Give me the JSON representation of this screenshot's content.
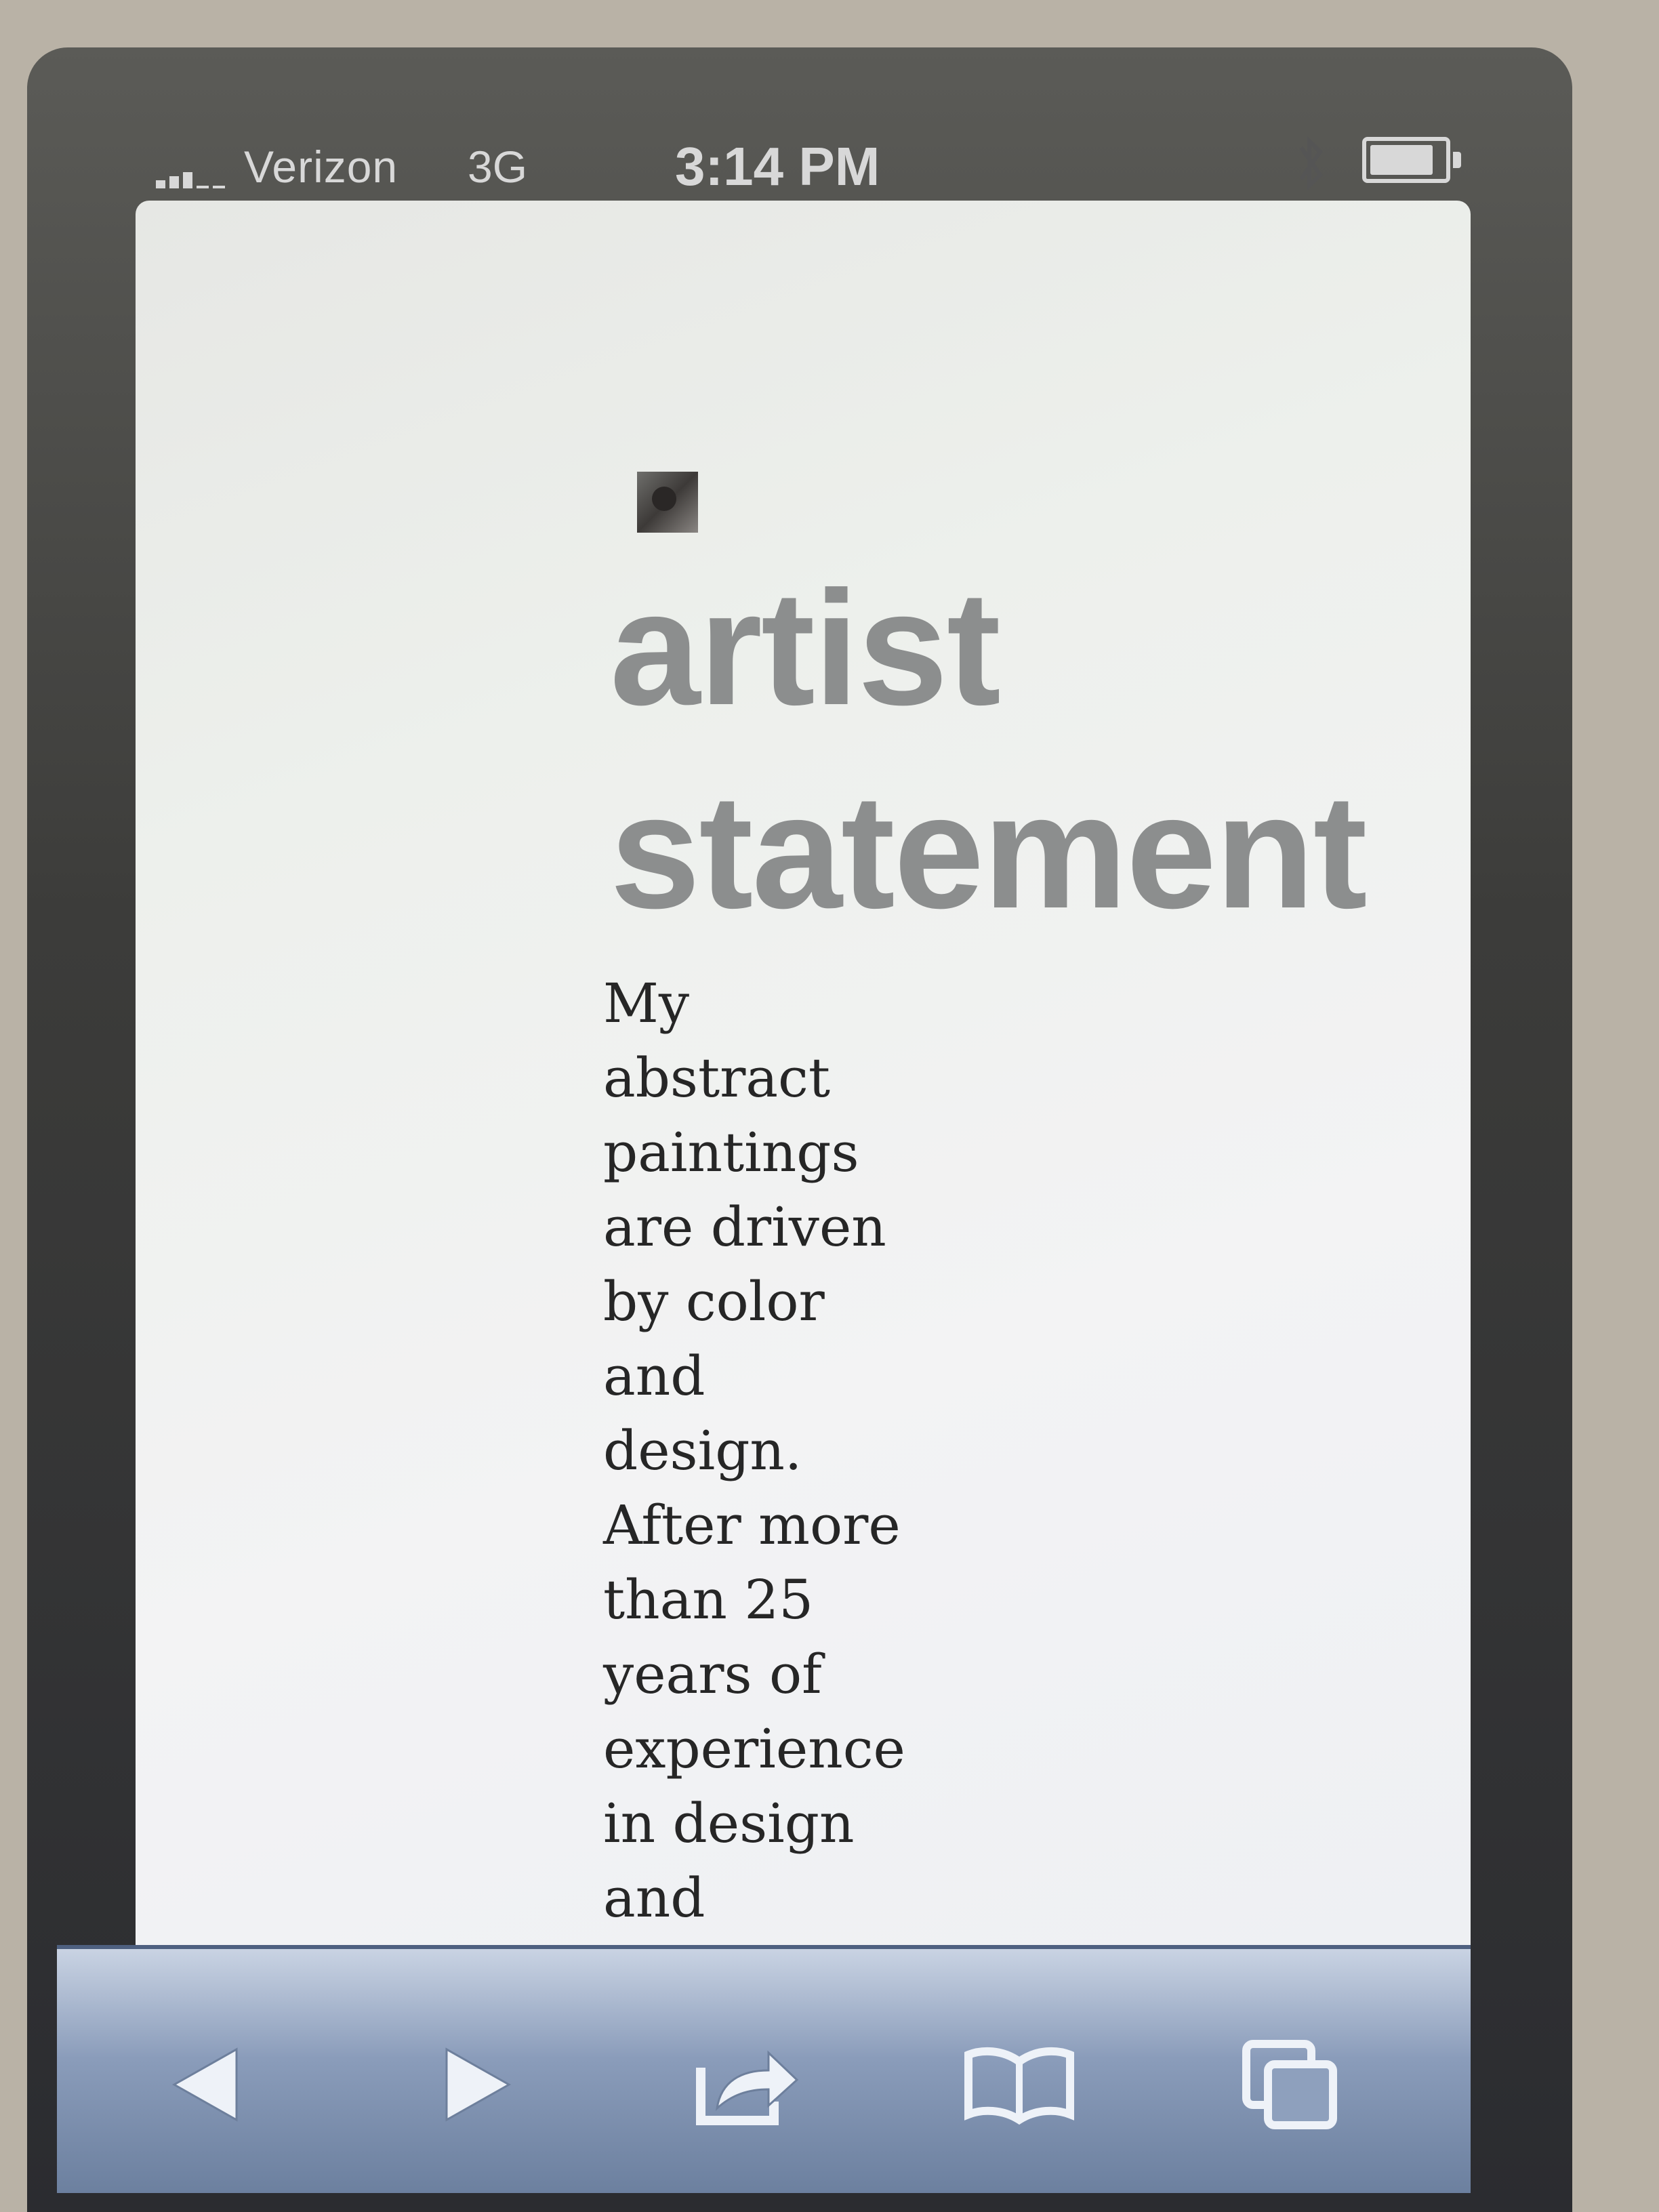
{
  "status_bar": {
    "carrier": "Verizon",
    "network": "3G",
    "time": "3:14 PM",
    "battery_level": 0.78
  },
  "page": {
    "heading_line_1": "artist",
    "heading_line_2": "statement",
    "body_lines": [
      "My",
      "abstract",
      "paintings",
      "are driven",
      "by color",
      "and",
      "design.",
      "After more",
      "than 25",
      "years of",
      "experience",
      "in design",
      "and"
    ]
  },
  "toolbar": {
    "items": [
      "back-icon",
      "forward-icon",
      "share-icon",
      "bookmarks-icon",
      "tabs-icon"
    ]
  },
  "colors": {
    "heading": "#8c8e8e",
    "body": "#262626",
    "toolbar": "#8a9cba"
  }
}
